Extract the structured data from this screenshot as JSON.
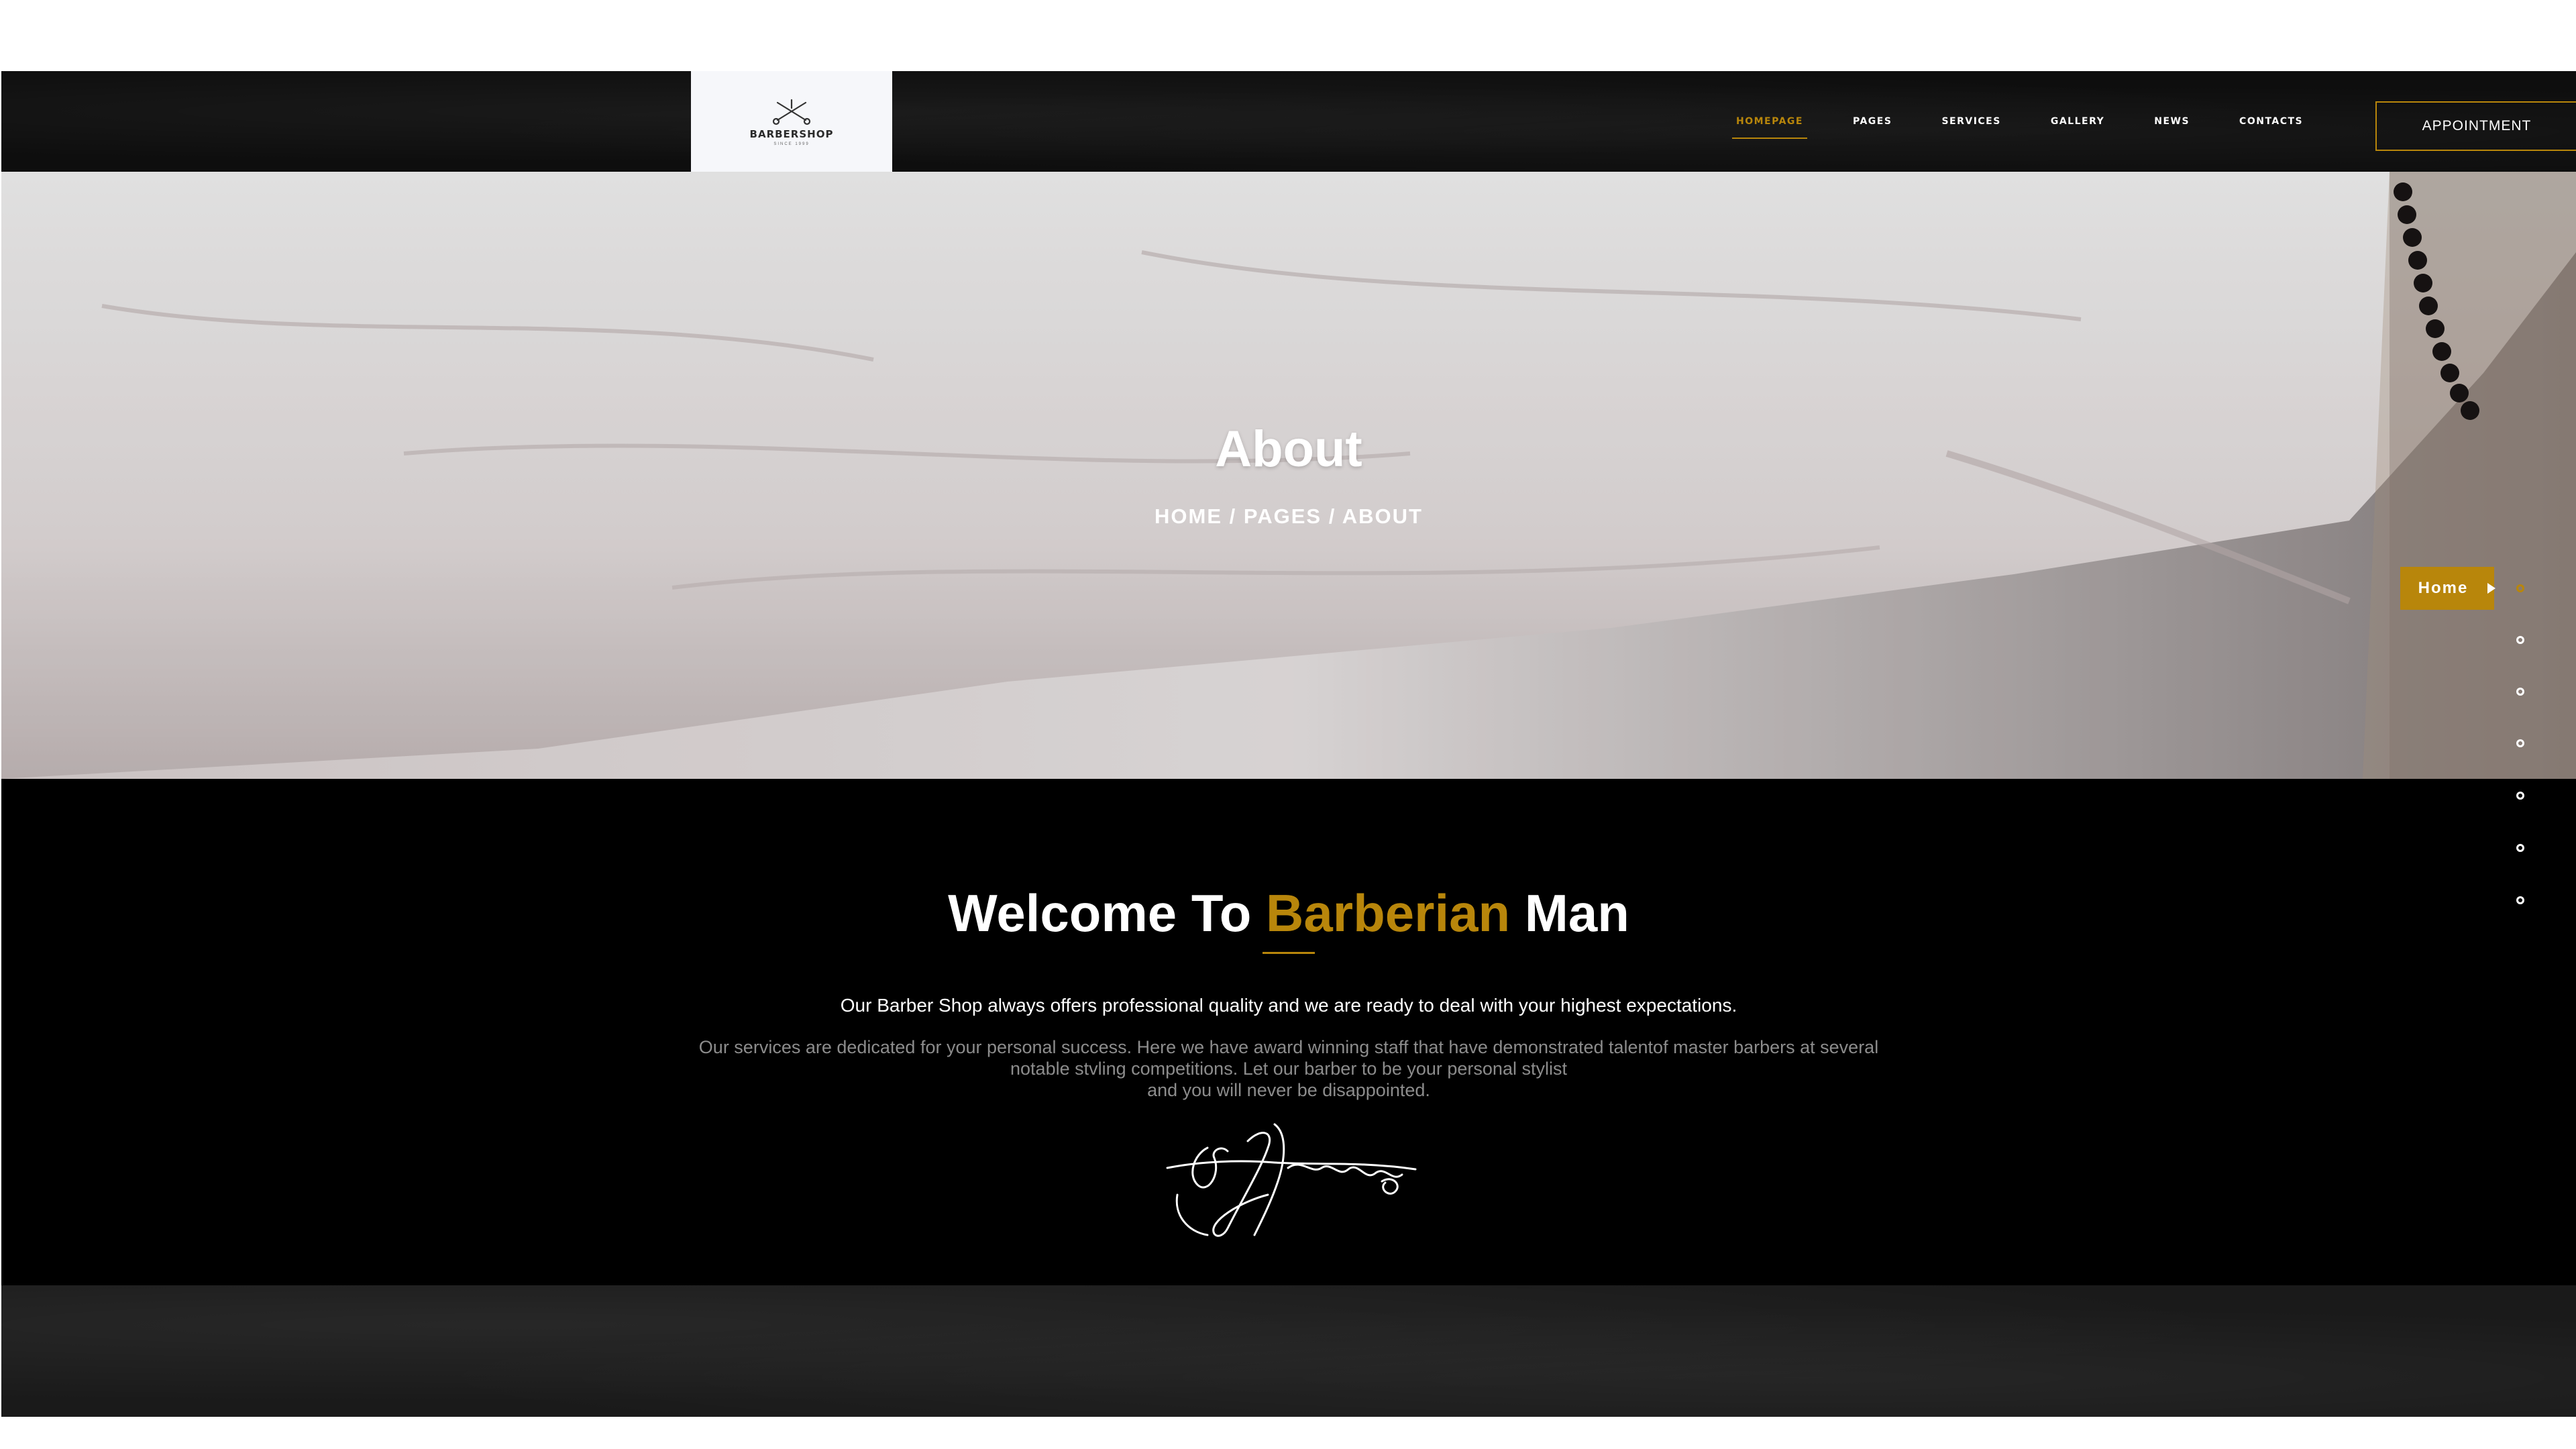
{
  "header": {
    "logo": {
      "text": "BARBERSHOP",
      "tagline": "SINCE 1999"
    },
    "nav": [
      "HOMEPAGE",
      "PAGES",
      "SERVICES",
      "GALLERY",
      "NEWS",
      "CONTACTS"
    ],
    "active_nav": "HOMEPAGE",
    "appointment_label": "APPOINTMENT"
  },
  "hero": {
    "title": "About",
    "breadcrumb": {
      "home": "HOME",
      "pages": "PAGES",
      "current": "ABOUT",
      "separator": " / "
    }
  },
  "welcome": {
    "title_pre": "Welcome To ",
    "title_accent": "Barberian",
    "title_post": " Man",
    "lead": "Our Barber Shop always offers professional quality and we are ready to deal with your highest expectations.",
    "body_line1": "Our services are dedicated for your personal success. Here we have award winning staff that have demonstrated talentof master barbers at several",
    "body_line2": "notable stvling competitions. Let our barber to be your personal stylist",
    "body_line3": "and you will never be disappointed."
  },
  "side_nav": {
    "tooltip": "Home",
    "dot_count": 7,
    "active_index": 0
  },
  "colors": {
    "accent": "#b8860b",
    "header_bg": "#0e0e0e",
    "body_bg": "#000000",
    "muted_text": "#8c8c8c"
  },
  "icons": [
    "barbershop-logo-icon",
    "signature-image"
  ]
}
